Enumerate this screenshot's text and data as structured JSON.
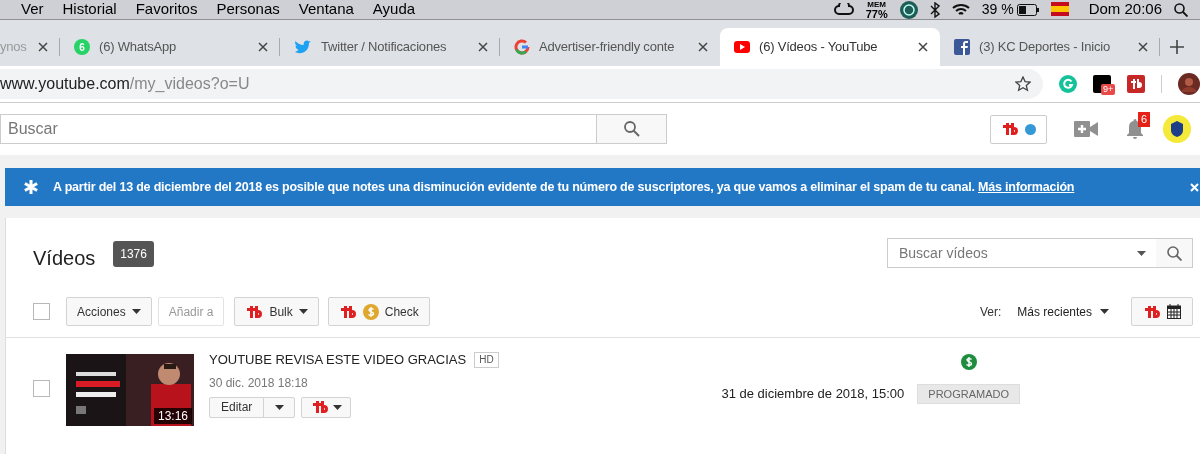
{
  "menu_bar": {
    "items": [
      "Ver",
      "Historial",
      "Favoritos",
      "Personas",
      "Ventana",
      "Ayuda"
    ],
    "mem_label": "MEM",
    "mem_value": "77%",
    "battery": "39 %",
    "clock": "Dom 20:06"
  },
  "tabs": [
    {
      "title": "ynos",
      "kind": "none",
      "selected": false
    },
    {
      "title": "(6) WhatsApp",
      "kind": "chat",
      "icon_badge": "6",
      "selected": false
    },
    {
      "title": "Twitter / Notificaciones",
      "kind": "bird",
      "selected": false
    },
    {
      "title": "Advertiser-friendly conte",
      "kind": "ring",
      "selected": false
    },
    {
      "title": "(6) Vídeos - YouTube",
      "kind": "play",
      "selected": true
    },
    {
      "title": "(3) KC Deportes - Inicio",
      "kind": "square",
      "selected": false
    }
  ],
  "address_bar": {
    "host": "www.youtube.com",
    "path": "/my_videos?o=U",
    "extension_badge": "9+"
  },
  "header": {
    "search_placeholder": "Buscar",
    "notification_count": "6"
  },
  "banner": {
    "text": "A partir del 13 de diciembre del 2018 es posible que notes una disminución evidente de tu número de suscriptores, ya que vamos a eliminar el spam de tu canal.",
    "link": "Más información"
  },
  "videos": {
    "title": "Vídeos",
    "count": "1376",
    "search_placeholder": "Buscar vídeos",
    "select_all_checked": false
  },
  "toolbar": {
    "actions": "Acciones",
    "add_to": "Añadir a",
    "add_to_disabled": true,
    "bulk": "Bulk",
    "check": "Check",
    "view_label": "Ver:",
    "sort": "Más recientes"
  },
  "rows": [
    {
      "title": "YOUTUBE REVISA ESTE VIDEO GRACIAS",
      "quality": "HD",
      "created": "30 dic. 2018 18:18",
      "duration": "13:16",
      "edit": "Editar",
      "monetized": true,
      "scheduled": "31 de diciembre de 2018, 15:00",
      "status": "PROGRAMADO",
      "checked": false
    }
  ]
}
